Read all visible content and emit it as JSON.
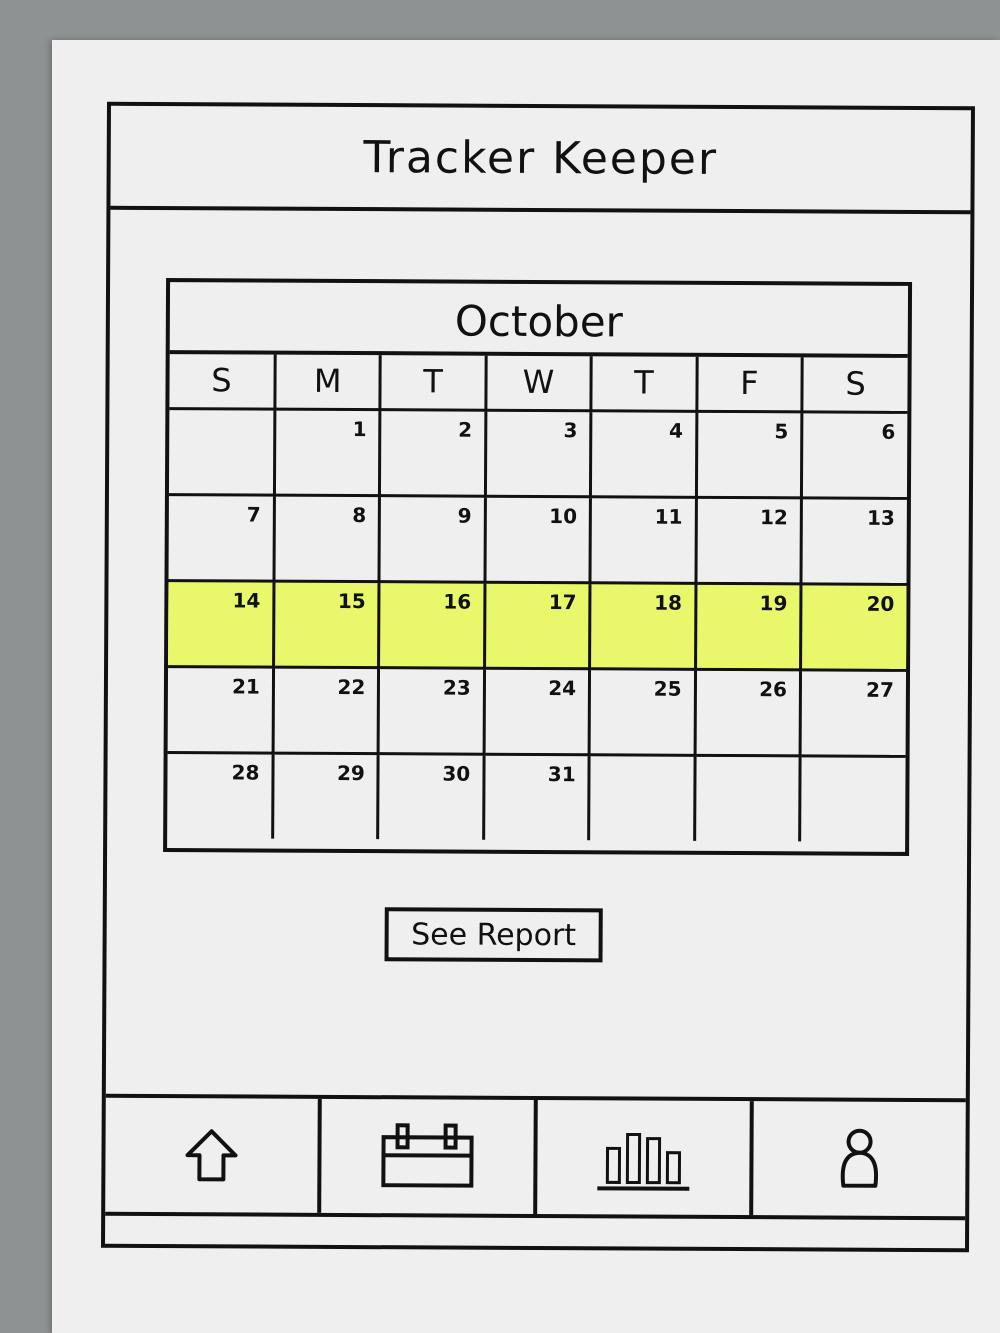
{
  "app": {
    "title": "Tracker Keeper"
  },
  "calendar": {
    "month": "October",
    "weekdays": [
      "S",
      "M",
      "T",
      "W",
      "T",
      "F",
      "S"
    ],
    "weeks": [
      [
        "",
        "1",
        "2",
        "3",
        "4",
        "5",
        "6"
      ],
      [
        "7",
        "8",
        "9",
        "10",
        "11",
        "12",
        "13"
      ],
      [
        "14",
        "15",
        "16",
        "17",
        "18",
        "19",
        "20"
      ],
      [
        "21",
        "22",
        "23",
        "24",
        "25",
        "26",
        "27"
      ],
      [
        "28",
        "29",
        "30",
        "31",
        "",
        "",
        ""
      ]
    ],
    "highlighted_week": 2,
    "highlight_color": "#e9f86a"
  },
  "actions": {
    "see_report": "See Report"
  },
  "tabbar": {
    "tabs": [
      {
        "icon": "home-icon",
        "active": false
      },
      {
        "icon": "calendar-icon",
        "active": true
      },
      {
        "icon": "bar-chart-icon",
        "active": false
      },
      {
        "icon": "profile-icon",
        "active": false
      }
    ]
  }
}
